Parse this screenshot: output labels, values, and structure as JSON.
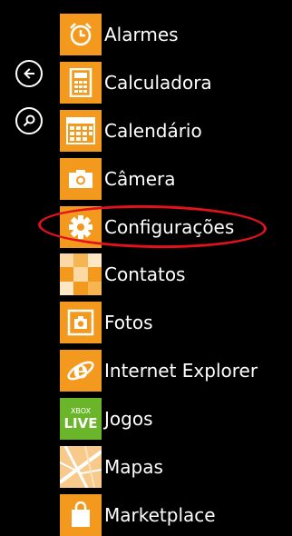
{
  "side_buttons": [
    {
      "id": "back",
      "icon": "back-arrow-icon"
    },
    {
      "id": "search",
      "icon": "search-icon"
    }
  ],
  "apps": [
    {
      "label": "Alarmes",
      "icon": "alarm-clock-icon",
      "tile_color": "#f39a1e"
    },
    {
      "label": "Calculadora",
      "icon": "calculator-icon",
      "tile_color": "#f39a1e"
    },
    {
      "label": "Calendário",
      "icon": "calendar-icon",
      "tile_color": "#f39a1e"
    },
    {
      "label": "Câmera",
      "icon": "camera-icon",
      "tile_color": "#f39a1e"
    },
    {
      "label": "Configurações",
      "icon": "gear-icon",
      "tile_color": "#f39a1e"
    },
    {
      "label": "Contatos",
      "icon": "contacts-icon",
      "tile_color": "#f39a1e"
    },
    {
      "label": "Fotos",
      "icon": "photos-icon",
      "tile_color": "#f39a1e"
    },
    {
      "label": "Internet Explorer",
      "icon": "internet-explorer-icon",
      "tile_color": "#f39a1e"
    },
    {
      "label": "Jogos",
      "icon": "xbox-live-icon",
      "tile_color": "#6bb52b",
      "tile_text_1": "XBOX",
      "tile_text_2": "LIVE"
    },
    {
      "label": "Mapas",
      "icon": "maps-icon",
      "tile_color": "#f39a1e"
    },
    {
      "label": "Marketplace",
      "icon": "marketplace-icon",
      "tile_color": "#f39a1e"
    }
  ],
  "highlight": {
    "color": "#e3111b",
    "target": "Configurações"
  }
}
